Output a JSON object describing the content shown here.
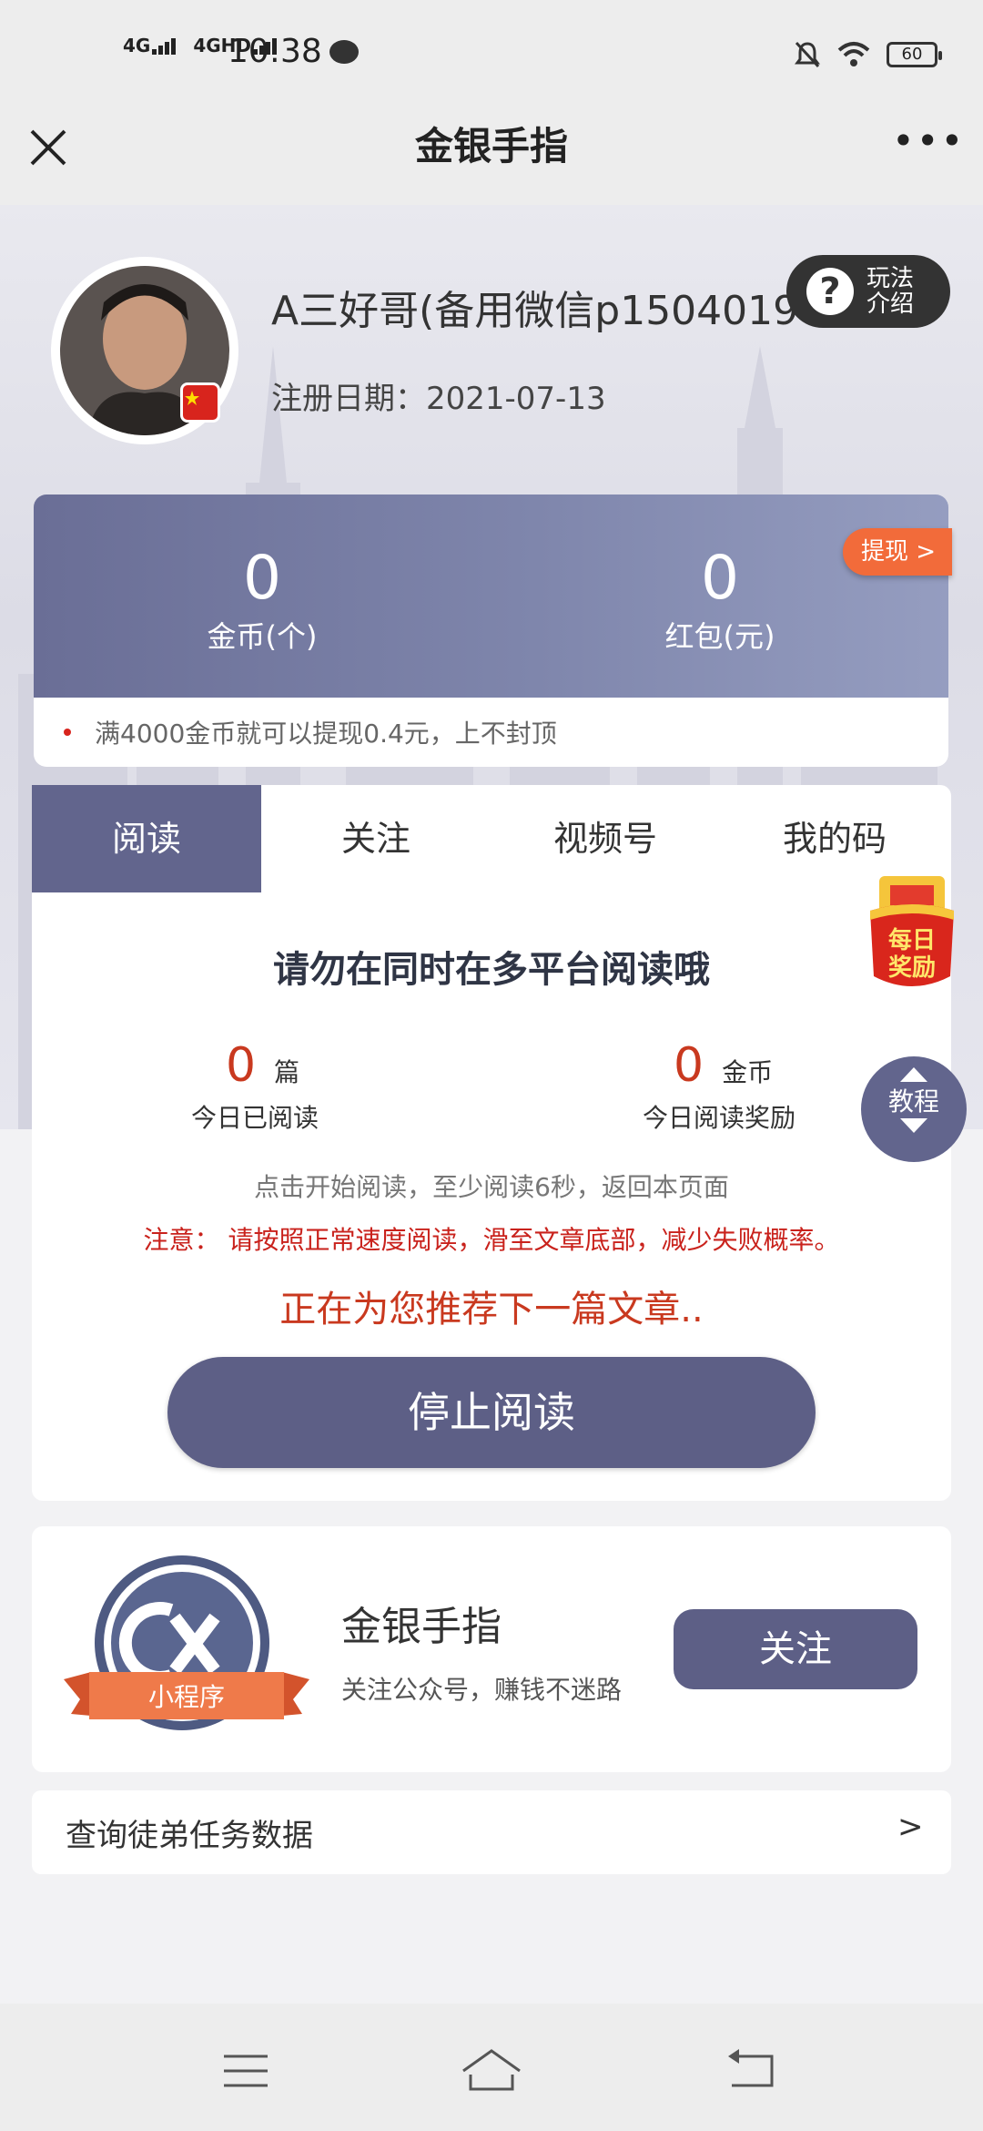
{
  "status_bar": {
    "network_1": "4G",
    "network_2": "4GHD",
    "time": "10:38",
    "battery": "60"
  },
  "header": {
    "title": "金银手指",
    "more": "•••"
  },
  "profile": {
    "username": "A三好哥(备用微信p15040190",
    "reg_date_label": "注册日期：",
    "reg_date": "2021-07-13",
    "rules_line1": "玩法",
    "rules_line2": "介绍"
  },
  "balance": {
    "coins_value": "0",
    "coins_label": "金币(个)",
    "redpacket_value": "0",
    "redpacket_label": "红包(元)",
    "withdraw_label": "提现 >",
    "tip": "满4000金币就可以提现0.4元，上不封顶"
  },
  "tabs": [
    {
      "label": "阅读"
    },
    {
      "label": "关注"
    },
    {
      "label": "视频号"
    },
    {
      "label": "我的码"
    }
  ],
  "reading": {
    "warning": "请勿在同时在多平台阅读哦",
    "today_read_value": "0",
    "today_read_unit": "篇",
    "today_read_label": "今日已阅读",
    "today_reward_value": "0",
    "today_reward_unit": "金币",
    "today_reward_label": "今日阅读奖励",
    "hint": "点击开始阅读，至少阅读6秒，返回本页面",
    "notice": "注意： 请按照正常速度阅读，滑至文章底部，减少失败概率。",
    "recommend": "正在为您推荐下一篇文章..",
    "stop_button": "停止阅读"
  },
  "floating": {
    "daily_reward_line1": "每日",
    "daily_reward_line2": "奖励",
    "tutorial": "教程"
  },
  "follow": {
    "badge": "小程序",
    "name": "金银手指",
    "desc": "关注公众号，赚钱不迷路",
    "button": "关注"
  },
  "query": {
    "label": "查询徒弟任务数据",
    "arrow": ">"
  },
  "colors": {
    "accent": "#62658d",
    "red": "#c9391f",
    "orange": "#f26b3a"
  }
}
